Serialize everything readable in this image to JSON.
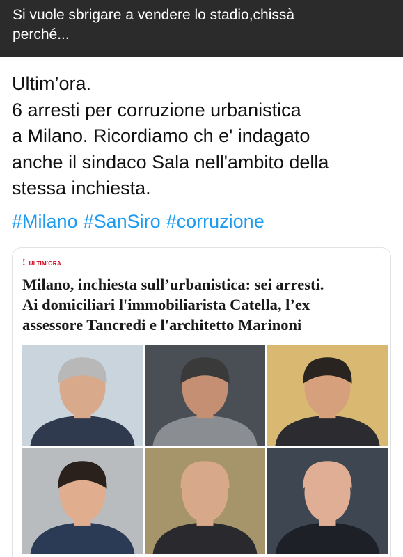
{
  "banner": {
    "text_line1": "Si vuole sbrigare a vendere lo stadio,chissà",
    "text_line2": "perché..."
  },
  "tweet": {
    "lines": [
      "Ultim’ora.",
      "6 arresti per corruzione urbanistica",
      "a Milano. Ricordiamo ch e' indagato",
      "anche il sindaco Sala nell'ambito della",
      "stessa inchiesta."
    ],
    "hashtags": [
      "#Milano",
      "#SanSiro",
      "#corruzione"
    ],
    "hashtag_color": "#1d9bf0"
  },
  "card": {
    "kicker": "ULTIM'ORA",
    "accent_color": "#d0021b",
    "headline_lines": [
      "Milano, inchiesta sull’urbanistica: sei arresti.",
      "Ai domiciliari l'immobiliarista Catella, l’ex",
      "assessore Tancredi e l'architetto Marinoni"
    ],
    "photos": [
      {
        "name": "portrait-1",
        "background": "#c9d4dc",
        "skin": "#d9a98c",
        "hair": "#b8b8b8",
        "suit": "#2f3a4f"
      },
      {
        "name": "portrait-2",
        "background": "#4a4f55",
        "skin": "#c48f72",
        "hair": "#3a3a3a",
        "suit": "#8a8d91"
      },
      {
        "name": "portrait-3",
        "background": "#d9b872",
        "skin": "#d6a07d",
        "hair": "#2a2420",
        "suit": "#2c2c30"
      },
      {
        "name": "portrait-4",
        "background": "#b9bcbf",
        "skin": "#e0ae8e",
        "hair": "#2a211d",
        "suit": "#2b3a55"
      },
      {
        "name": "portrait-5",
        "background": "#a6956b",
        "skin": "#d8a88a",
        "hair": "#d8a88a",
        "suit": "#2a2a2e"
      },
      {
        "name": "portrait-6",
        "background": "#3e4651",
        "skin": "#e0ae95",
        "hair": "#e0ae95",
        "suit": "#1e2027"
      }
    ]
  }
}
